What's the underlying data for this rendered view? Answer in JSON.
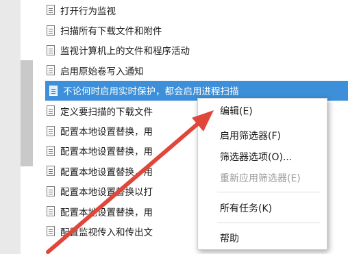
{
  "policy_list": {
    "items": [
      {
        "label": "打开行为监视"
      },
      {
        "label": "扫描所有下载文件和附件"
      },
      {
        "label": "监视计算机上的文件和程序活动"
      },
      {
        "label": "启用原始卷写入通知"
      },
      {
        "label": "不论何时启用实时保护，都会启用进程扫描",
        "selected": true
      },
      {
        "label": "定义要扫描的下载文件"
      },
      {
        "label": "配置本地设置替换，用"
      },
      {
        "label": "配置本地设置替换，用"
      },
      {
        "label": "配置本地设置替换，用"
      },
      {
        "label": "配置本地设置替换以打"
      },
      {
        "label": "配置本地设置替换，用"
      },
      {
        "label": "配置监视传入和传出文"
      }
    ]
  },
  "context_menu": {
    "edit": "编辑(E)",
    "enable_filter": "启用筛选器(F)",
    "filter_options": "筛选器选项(O)...",
    "reapply_filter": "重新应用筛选器(E)",
    "all_tasks": "所有任务(K)",
    "help": "帮助"
  },
  "colors": {
    "selection": "#3c8fd8",
    "annotation_arrow": "#e0463a"
  }
}
